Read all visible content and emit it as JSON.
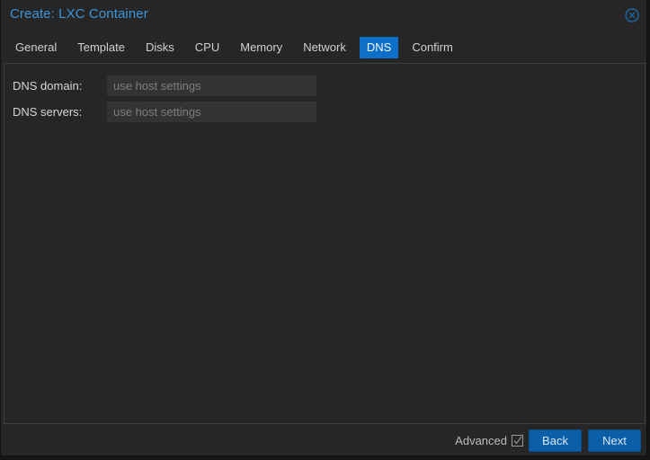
{
  "window": {
    "title": "Create: LXC Container",
    "close_icon": "close-circle-icon"
  },
  "tabs": [
    {
      "label": "General",
      "active": false
    },
    {
      "label": "Template",
      "active": false
    },
    {
      "label": "Disks",
      "active": false
    },
    {
      "label": "CPU",
      "active": false
    },
    {
      "label": "Memory",
      "active": false
    },
    {
      "label": "Network",
      "active": false
    },
    {
      "label": "DNS",
      "active": true
    },
    {
      "label": "Confirm",
      "active": false
    }
  ],
  "form": {
    "dns_domain": {
      "label": "DNS domain:",
      "value": "",
      "placeholder": "use host settings"
    },
    "dns_servers": {
      "label": "DNS servers:",
      "value": "",
      "placeholder": "use host settings"
    }
  },
  "footer": {
    "advanced_label": "Advanced",
    "advanced_checked": true,
    "back_label": "Back",
    "next_label": "Next"
  },
  "colors": {
    "accent": "#0d6fc7",
    "title": "#3d95d9",
    "background": "#262626"
  }
}
